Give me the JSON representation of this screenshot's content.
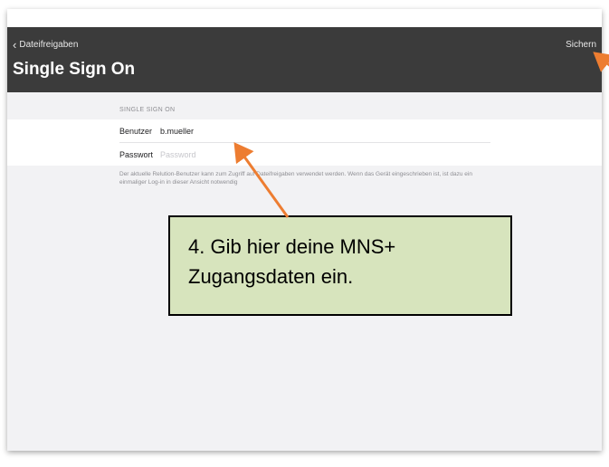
{
  "nav": {
    "back_label": "Dateifreigaben",
    "save_label": "Sichern",
    "title": "Single Sign On"
  },
  "form": {
    "section_header": "SINGLE SIGN ON",
    "user_label": "Benutzer",
    "user_value": "b.mueller",
    "password_label": "Passwort",
    "password_placeholder": "Password",
    "footer_note": "Der aktuelle Relution-Benutzer kann zum Zugriff auf Dateifreigaben verwendet werden. Wenn das Gerät eingeschrieben ist, ist dazu ein einmaliger Log-in in dieser Ansicht notwendig"
  },
  "annotation": {
    "line1": "4. Gib hier deine MNS+",
    "line2": "Zugangsdaten ein."
  },
  "colors": {
    "nav_bar": "#3b3b3b",
    "callout_fill": "#d7e4bd",
    "arrow": "#ed7d31"
  }
}
